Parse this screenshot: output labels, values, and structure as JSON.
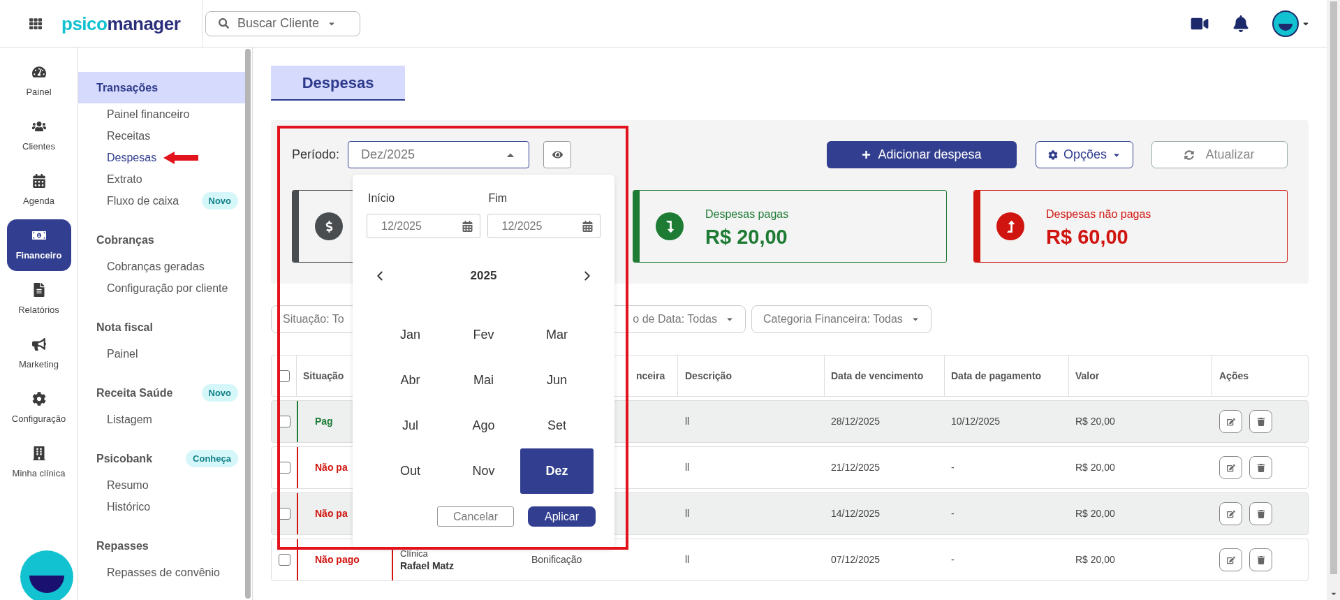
{
  "top_bar": {
    "logo_prefix": "psico",
    "logo_suffix": "manager",
    "search_placeholder": "Buscar Cliente"
  },
  "nav_rail": [
    {
      "label": "Painel",
      "selected": false
    },
    {
      "label": "Clientes",
      "selected": false
    },
    {
      "label": "Agenda",
      "selected": false
    },
    {
      "label": "Financeiro",
      "selected": true
    },
    {
      "label": "Relatórios",
      "selected": false
    },
    {
      "label": "Marketing",
      "selected": false
    },
    {
      "label": "Configuração",
      "selected": false
    },
    {
      "label": "Minha clínica",
      "selected": false
    }
  ],
  "submenu": [
    {
      "title": "Transações",
      "highlighted": true,
      "items": [
        {
          "label": "Painel financeiro",
          "selected": false
        },
        {
          "label": "Receitas",
          "selected": false
        },
        {
          "label": "Despesas",
          "selected": true
        },
        {
          "label": "Extrato",
          "selected": false
        },
        {
          "label": "Fluxo de caixa",
          "selected": false,
          "badge": "Novo"
        }
      ]
    },
    {
      "title": "Cobranças",
      "highlighted": false,
      "items": [
        {
          "label": "Cobranças geradas",
          "selected": false
        },
        {
          "label": "Configuração por cliente",
          "selected": false
        }
      ]
    },
    {
      "title": "Nota fiscal",
      "highlighted": false,
      "items": [
        {
          "label": "Painel",
          "selected": false
        }
      ]
    },
    {
      "title": "Receita Saúde",
      "badge": "Novo",
      "highlighted": false,
      "items": [
        {
          "label": "Listagem",
          "selected": false
        }
      ]
    },
    {
      "title": "Psicobank",
      "badge": "Conheça",
      "highlighted": false,
      "items": [
        {
          "label": "Resumo",
          "selected": false
        },
        {
          "label": "Histórico",
          "selected": false
        }
      ]
    },
    {
      "title": "Repasses",
      "highlighted": false,
      "items": [
        {
          "label": "Repasses de convênio",
          "selected": false
        }
      ]
    }
  ],
  "page_tab": "Despesas",
  "period": {
    "label": "Período:",
    "value": "Dez/2025"
  },
  "actions": {
    "add": "Adicionar despesa",
    "options": "Opções",
    "refresh": "Atualizar"
  },
  "cards": [
    {
      "kind": "neutral"
    },
    {
      "kind": "paid",
      "label": "Despesas pagas",
      "value": "R$ 20,00"
    },
    {
      "kind": "unpaid",
      "label": "Despesas não pagas",
      "value": "R$ 60,00"
    }
  ],
  "filters": [
    {
      "text": "Situação: To",
      "caret": false
    },
    {
      "text": "o de Data: Todas",
      "caret": true
    },
    {
      "text": "Categoria Financeira: Todas",
      "caret": true
    }
  ],
  "table": {
    "header_checked": false,
    "columns": {
      "status": "Situação",
      "category": "nceira",
      "description": "Descrição",
      "due": "Data de vencimento",
      "paid_on": "Data de pagamento",
      "value": "Valor",
      "actions": "Ações"
    },
    "rows": [
      {
        "checked": false,
        "kind": "paid",
        "status": "Pag",
        "description": "ll",
        "due": "28/12/2025",
        "paid_on": "10/12/2025",
        "value": "R$ 20,00"
      },
      {
        "checked": false,
        "kind": "unpaid",
        "status": "Não pa",
        "description": "ll",
        "due": "21/12/2025",
        "paid_on": "-",
        "value": "R$ 20,00"
      },
      {
        "checked": false,
        "kind": "unpaid",
        "status": "Não pa",
        "description": "ll",
        "due": "14/12/2025",
        "paid_on": "-",
        "value": "R$ 20,00"
      },
      {
        "checked": false,
        "kind": "unpaid",
        "status": "Não pago",
        "client_type": "Clínica",
        "client_name": "Rafael Matz",
        "category": "Bonificação",
        "description": "ll",
        "due": "07/12/2025",
        "paid_on": "-",
        "value": "R$ 20,00"
      }
    ]
  },
  "period_picker": {
    "start_label": "Início",
    "start_value": "12/2025",
    "end_label": "Fim",
    "end_value": "12/2025",
    "year": "2025",
    "months": [
      {
        "label": "Jan",
        "selected": false
      },
      {
        "label": "Fev",
        "selected": false
      },
      {
        "label": "Mar",
        "selected": false
      },
      {
        "label": "Abr",
        "selected": false
      },
      {
        "label": "Mai",
        "selected": false
      },
      {
        "label": "Jun",
        "selected": false
      },
      {
        "label": "Jul",
        "selected": false
      },
      {
        "label": "Ago",
        "selected": false
      },
      {
        "label": "Set",
        "selected": false
      },
      {
        "label": "Out",
        "selected": false
      },
      {
        "label": "Nov",
        "selected": false
      },
      {
        "label": "Dez",
        "selected": true
      }
    ],
    "cancel": "Cancelar",
    "apply": "Aplicar"
  }
}
